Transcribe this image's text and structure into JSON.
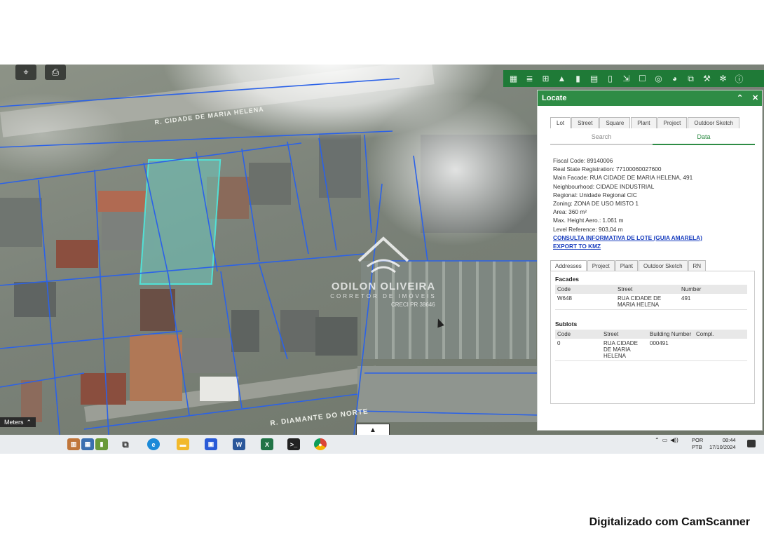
{
  "map": {
    "street_top": "R. CIDADE DE MARIA HELENA",
    "street_bottom": "R. DIAMANTE DO NORTE",
    "scale_label": "Meters",
    "watermark": {
      "name": "ODILON OLIVEIRA",
      "subtitle": "CORRETOR DE IMÓVEIS",
      "creci": "CRECI PR 38646"
    }
  },
  "locate": {
    "title": "Locate",
    "tabs": [
      "Lot",
      "Street",
      "Square",
      "Plant",
      "Project",
      "Outdoor Sketch"
    ],
    "subtabs": [
      "Search",
      "Data"
    ],
    "fields": [
      "Fiscal Code: 89140006",
      "Real State Registration: 77100060027600",
      "Main Facade: RUA CIDADE DE MARIA HELENA, 491",
      "Neighbourhood: CIDADE INDUSTRIAL",
      "Regional: Unidade Regional CIC",
      "Zoning: ZONA DE USO MISTO 1",
      "Area: 360 m²",
      "Max. Height Aero.: 1.061 m",
      "Level Reference: 903,04 m"
    ],
    "link_consulta": "CONSULTA INFORMATIVA DE LOTE (GUIA AMARELA)",
    "link_export": "EXPORT TO KMZ",
    "detail_tabs": [
      "Addresses",
      "Project",
      "Plant",
      "Outdoor Sketch",
      "RN"
    ],
    "facades": {
      "title": "Facades",
      "headers": [
        "Code",
        "Street",
        "Number"
      ],
      "rows": [
        [
          "W648",
          "RUA CIDADE DE MARIA HELENA",
          "491"
        ]
      ]
    },
    "sublots": {
      "title": "Sublots",
      "headers": [
        "Code",
        "Street",
        "Building Number",
        "Compl."
      ],
      "rows": [
        [
          "0",
          "RUA CIDADE DE MARIA HELENA",
          "000491",
          ""
        ]
      ]
    }
  },
  "taskbar": {
    "lang_top": "POR",
    "lang_bottom": "PTB",
    "time": "08:44",
    "date": "17/10/2024"
  },
  "footer": "Digitalizado com CamScanner"
}
